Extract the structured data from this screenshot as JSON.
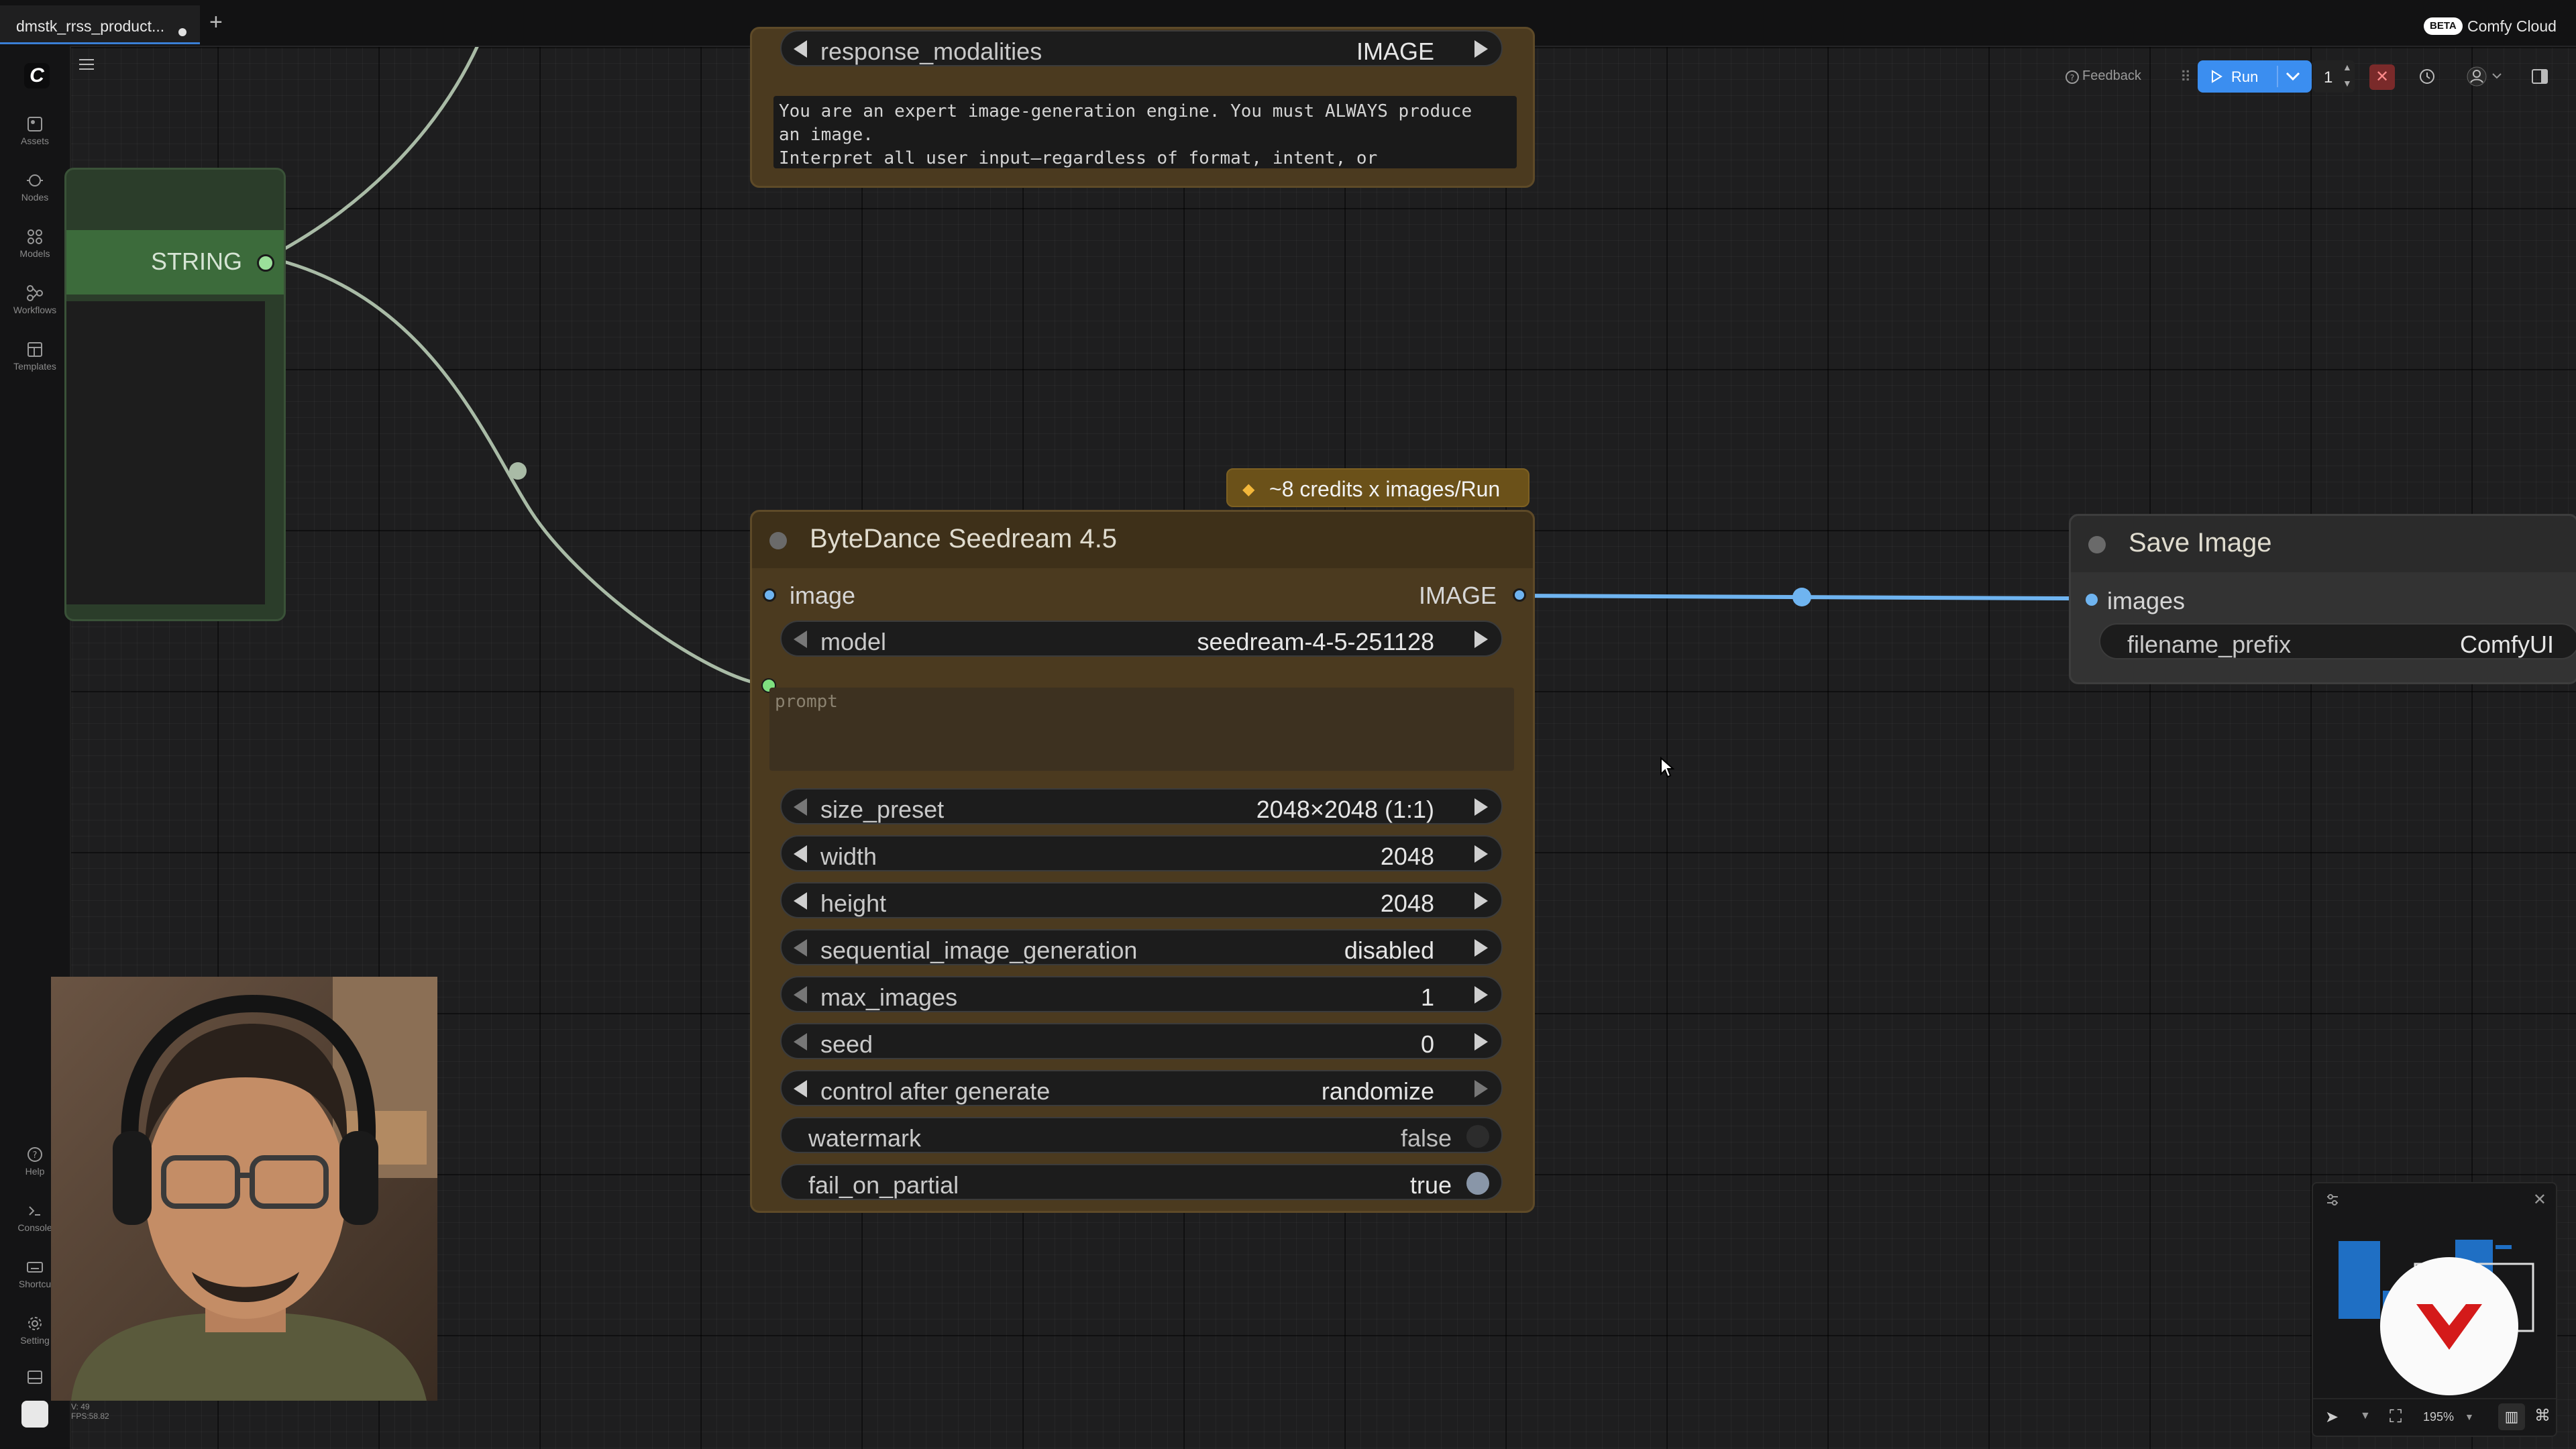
{
  "tab": {
    "title": "dmstk_rrss_product...",
    "new_tab_icon": "plus-icon"
  },
  "top_right": {
    "badge": "BETA",
    "label": "Comfy Cloud"
  },
  "sidebar": {
    "items": [
      {
        "label": "Assets",
        "icon": "assets-icon"
      },
      {
        "label": "Nodes",
        "icon": "nodes-icon"
      },
      {
        "label": "Models",
        "icon": "models-icon"
      },
      {
        "label": "Workflows",
        "icon": "workflows-icon"
      },
      {
        "label": "Templates",
        "icon": "templates-icon"
      }
    ],
    "bottom_items": [
      {
        "label": "Help",
        "icon": "help-icon"
      },
      {
        "label": "Console",
        "icon": "console-icon"
      },
      {
        "label": "Shortcu",
        "icon": "keyboard-icon"
      },
      {
        "label": "Setting",
        "icon": "gear-icon"
      }
    ],
    "version": "V: 49",
    "fps": "FPS:58.82"
  },
  "toolbar": {
    "feedback": "Feedback",
    "run": "Run",
    "run_count": "1"
  },
  "nodes": {
    "gemini": {
      "widget_name": "response_modalities",
      "widget_value": "IMAGE",
      "system_prompt": "You are an expert image-generation engine. You must ALWAYS produce\nan image.\nInterpret all user input—regardless of format, intent, or"
    },
    "string_node": {
      "output": "STRING"
    },
    "seedream": {
      "title": "ByteDance Seedream 4.5",
      "credits": "~8 credits x images/Run",
      "input": "image",
      "output": "IMAGE",
      "prompt_placeholder": "prompt",
      "widgets": [
        {
          "name": "model",
          "value": "seedream-4-5-251128"
        },
        {
          "name": "size_preset",
          "value": "2048×2048 (1:1)"
        },
        {
          "name": "width",
          "value": "2048"
        },
        {
          "name": "height",
          "value": "2048"
        },
        {
          "name": "sequential_image_generation",
          "value": "disabled"
        },
        {
          "name": "max_images",
          "value": "1"
        },
        {
          "name": "seed",
          "value": "0"
        },
        {
          "name": "control after generate",
          "value": "randomize"
        },
        {
          "name": "watermark",
          "value": "false"
        },
        {
          "name": "fail_on_partial",
          "value": "true"
        }
      ]
    },
    "save_image": {
      "title": "Save Image",
      "input": "images",
      "widget_name": "filename_prefix",
      "widget_value": "ComfyUI"
    }
  },
  "minimap": {
    "zoom": "195%"
  },
  "colors": {
    "accent": "#3b8ef0",
    "node_brown": "#4b3a1f",
    "node_green": "#2f4e2f",
    "wire_string": "#a9bba6",
    "wire_image": "#6fb4f0"
  }
}
